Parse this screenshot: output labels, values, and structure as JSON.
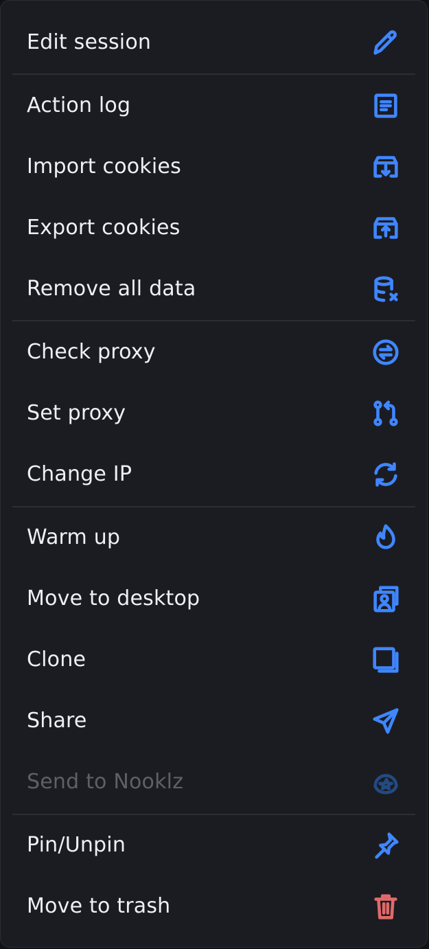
{
  "menu": {
    "items": [
      {
        "label": "Edit session",
        "icon": "pencil-icon"
      },
      {
        "label": "Action log",
        "icon": "document-list-icon"
      },
      {
        "label": "Import cookies",
        "icon": "box-download-icon"
      },
      {
        "label": "Export cookies",
        "icon": "box-upload-icon"
      },
      {
        "label": "Remove all data",
        "icon": "database-x-icon"
      },
      {
        "label": "Check proxy",
        "icon": "circle-arrows-icon"
      },
      {
        "label": "Set proxy",
        "icon": "git-compare-icon"
      },
      {
        "label": "Change IP",
        "icon": "refresh-icon"
      },
      {
        "label": "Warm up",
        "icon": "flame-icon"
      },
      {
        "label": "Move to desktop",
        "icon": "user-photos-icon"
      },
      {
        "label": "Clone",
        "icon": "copy-icon"
      },
      {
        "label": "Share",
        "icon": "send-icon"
      },
      {
        "label": "Send to Nooklz",
        "icon": "nooklz-icon",
        "disabled": true
      },
      {
        "label": "Pin/Unpin",
        "icon": "pin-icon"
      },
      {
        "label": "Move to trash",
        "icon": "trash-icon"
      }
    ]
  },
  "colors": {
    "background": "#1b1c21",
    "text": "#eef0f4",
    "text_disabled": "#5d6068",
    "accent": "#3f86ff",
    "accent_disabled": "#234a82",
    "danger": "#e06a6a",
    "divider": "#2c2e35"
  }
}
